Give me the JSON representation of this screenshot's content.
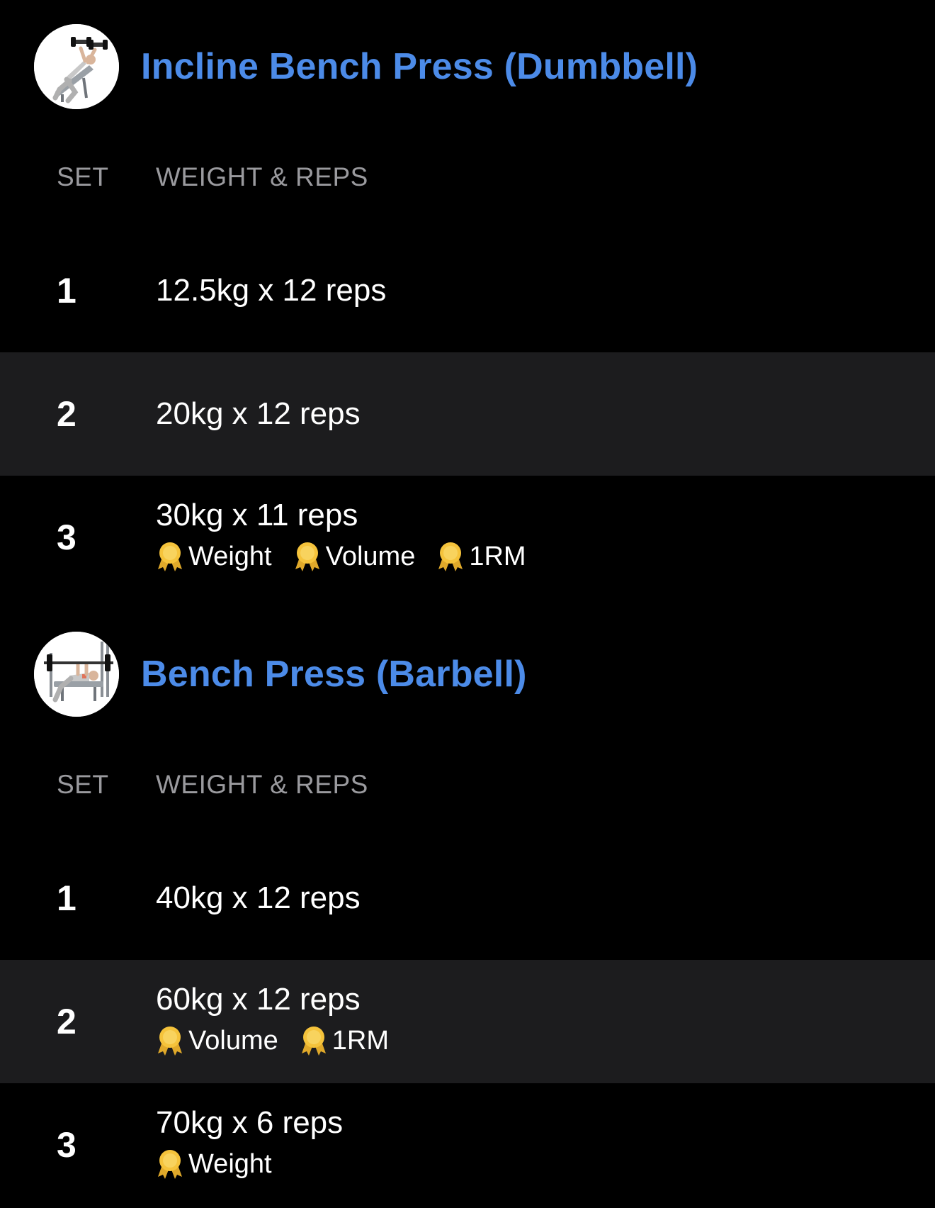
{
  "accent_color": "#4c8be8",
  "badge_color": "#f5c33b",
  "exercises": [
    {
      "title": "Incline Bench Press (Dumbbell)",
      "thumbnail_icon": "incline-dumbbell-press-icon",
      "col_set": "SET",
      "col_weight_reps": "WEIGHT & REPS",
      "sets": [
        {
          "set": "1",
          "weight_reps": "12.5kg x 12 reps",
          "badges": []
        },
        {
          "set": "2",
          "weight_reps": "20kg x 12 reps",
          "badges": []
        },
        {
          "set": "3",
          "weight_reps": "30kg x 11 reps",
          "badges": [
            "Weight",
            "Volume",
            "1RM"
          ]
        }
      ]
    },
    {
      "title": "Bench Press (Barbell)",
      "thumbnail_icon": "barbell-bench-press-icon",
      "col_set": "SET",
      "col_weight_reps": "WEIGHT & REPS",
      "sets": [
        {
          "set": "1",
          "weight_reps": "40kg x 12 reps",
          "badges": []
        },
        {
          "set": "2",
          "weight_reps": "60kg x 12 reps",
          "badges": [
            "Volume",
            "1RM"
          ]
        },
        {
          "set": "3",
          "weight_reps": "70kg x 6 reps",
          "badges": [
            "Weight"
          ]
        }
      ]
    }
  ]
}
